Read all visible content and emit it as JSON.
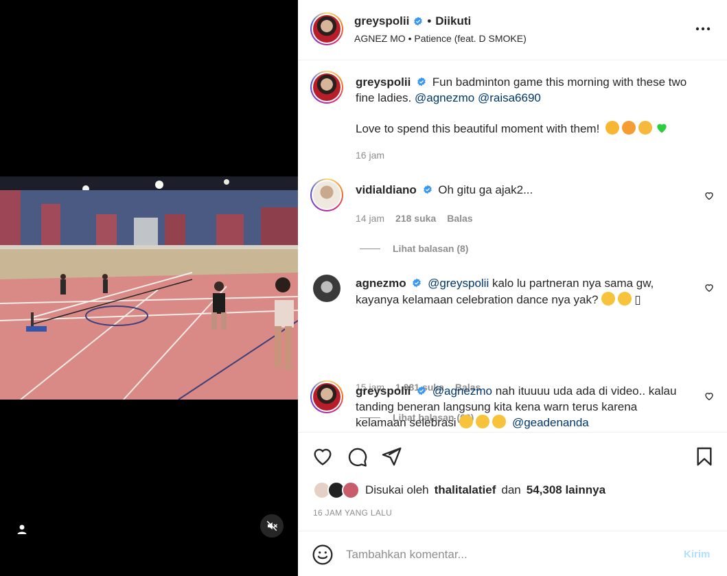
{
  "post": {
    "username": "greyspolii",
    "follow_status": "Diikuti",
    "separator": "•",
    "audio_artist": "AGNEZ MO",
    "audio_sep": "•",
    "audio_title": "Patience (feat. D SMOKE)"
  },
  "caption": {
    "username": "greyspolii",
    "text_before": "Fun badminton game this morning with these two fine ladies.",
    "mention1": "@agnezmo",
    "mention2": "@raisa6690",
    "text_line2": "Love to spend this beautiful moment with them!",
    "emojis": [
      "smiling-face-with-hearts",
      "heart-eyes",
      "face-blowing-kiss",
      "green-heart"
    ],
    "time": "16 jam"
  },
  "comments": [
    {
      "username": "vidialdiano",
      "text": "Oh gitu ga ajak2...",
      "time": "14 jam",
      "likes": "218 suka",
      "reply_label": "Balas",
      "view_replies": "Lihat balasan (8)"
    },
    {
      "username": "agnezmo",
      "mention": "@greyspolii",
      "text": "kalo lu partneran nya sama gw, kayanya kelamaan celebration dance nya yak?",
      "trailing_glyph": "▯",
      "time": "15 jam",
      "likes": "1,081 suka",
      "reply_label": "Balas",
      "view_replies": "Lihat balasan (66)"
    },
    {
      "username": "greyspolii",
      "mention": "@agnezmo",
      "text": "nah ituuuu uda ada di video.. kalau tanding beneran langsung kita kena warn terus karena kelamaan selebrasi",
      "mention_end": "@geadenanda"
    }
  ],
  "likes": {
    "prefix": "Disukai oleh",
    "liker": "thalitalatief",
    "conjunction": "dan",
    "others": "54,308 lainnya"
  },
  "timestamp": "16 JAM YANG LALU",
  "add_comment": {
    "placeholder": "Tambahkan komentar...",
    "post_label": "Kirim"
  },
  "colors": {
    "verified": "#3897f0",
    "mention": "#00376b",
    "muted_text": "#8e8e8e",
    "post_button_disabled": "#b2dffc",
    "court_floor": "#d98a86"
  },
  "icons": [
    "verified-badge-icon",
    "more-options-icon",
    "heart-icon",
    "comment-icon",
    "share-icon",
    "bookmark-icon",
    "emoji-icon",
    "user-tag-icon",
    "muted-audio-icon"
  ]
}
